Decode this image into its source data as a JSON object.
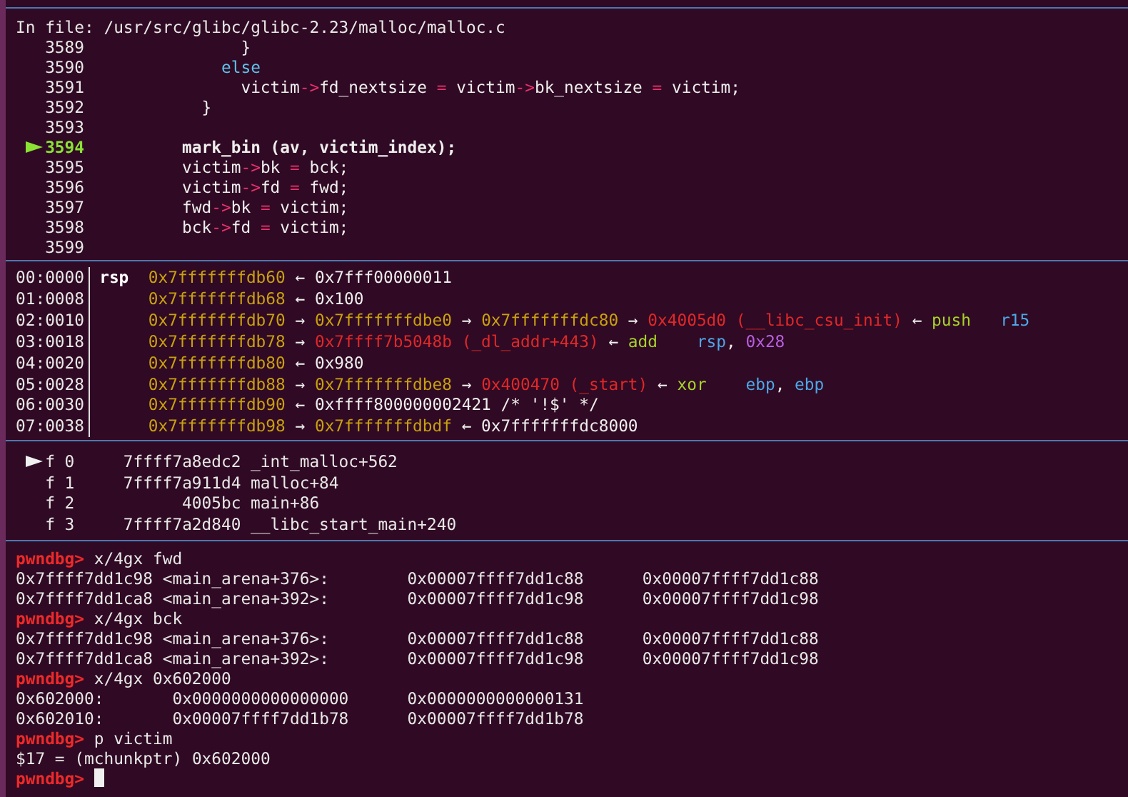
{
  "source": {
    "file_label": "In file: /usr/src/glibc/glibc-2.23/malloc/malloc.c",
    "lines": [
      {
        "number": "3589",
        "current": false,
        "code": [
          {
            "kind": "plain",
            "text": "                }"
          }
        ]
      },
      {
        "number": "3590",
        "current": false,
        "code": [
          {
            "kind": "keyword",
            "text": "              else"
          }
        ]
      },
      {
        "number": "3591",
        "current": false,
        "code": [
          {
            "kind": "plain",
            "text": "                victim"
          },
          {
            "kind": "op",
            "text": "->"
          },
          {
            "kind": "plain",
            "text": "fd_nextsize "
          },
          {
            "kind": "op",
            "text": "="
          },
          {
            "kind": "plain",
            "text": " victim"
          },
          {
            "kind": "op",
            "text": "->"
          },
          {
            "kind": "plain",
            "text": "bk_nextsize "
          },
          {
            "kind": "op",
            "text": "="
          },
          {
            "kind": "plain",
            "text": " victim;"
          }
        ]
      },
      {
        "number": "3592",
        "current": false,
        "code": [
          {
            "kind": "plain",
            "text": "            }"
          }
        ]
      },
      {
        "number": "3593",
        "current": false
      },
      {
        "number": "3594",
        "current": true,
        "code": [
          {
            "kind": "plain",
            "text": "          mark_bin (av, victim_index);"
          }
        ]
      },
      {
        "number": "3595",
        "current": false,
        "code": [
          {
            "kind": "plain",
            "text": "          victim"
          },
          {
            "kind": "op",
            "text": "->"
          },
          {
            "kind": "plain",
            "text": "bk "
          },
          {
            "kind": "op",
            "text": "="
          },
          {
            "kind": "plain",
            "text": " bck;"
          }
        ]
      },
      {
        "number": "3596",
        "current": false,
        "code": [
          {
            "kind": "plain",
            "text": "          victim"
          },
          {
            "kind": "op",
            "text": "->"
          },
          {
            "kind": "plain",
            "text": "fd "
          },
          {
            "kind": "op",
            "text": "="
          },
          {
            "kind": "plain",
            "text": " fwd;"
          }
        ]
      },
      {
        "number": "3597",
        "current": false,
        "code": [
          {
            "kind": "plain",
            "text": "          fwd"
          },
          {
            "kind": "op",
            "text": "->"
          },
          {
            "kind": "plain",
            "text": "bk "
          },
          {
            "kind": "op",
            "text": "="
          },
          {
            "kind": "plain",
            "text": " victim;"
          }
        ]
      },
      {
        "number": "3598",
        "current": false,
        "code": [
          {
            "kind": "plain",
            "text": "          bck"
          },
          {
            "kind": "op",
            "text": "->"
          },
          {
            "kind": "plain",
            "text": "fd "
          },
          {
            "kind": "op",
            "text": "="
          },
          {
            "kind": "plain",
            "text": " victim;"
          }
        ]
      },
      {
        "number": "3599",
        "current": false
      }
    ]
  },
  "stack": [
    {
      "offset": "00:0000",
      "register": "rsp",
      "segments": [
        {
          "kind": "address",
          "text": "0x7fffffffdb60"
        },
        {
          "kind": "plain",
          "text": " ← 0x7fff00000011"
        }
      ]
    },
    {
      "offset": "01:0008",
      "segments": [
        {
          "kind": "address",
          "text": "0x7fffffffdb68"
        },
        {
          "kind": "plain",
          "text": " ← 0x100"
        }
      ]
    },
    {
      "offset": "02:0010",
      "segments": [
        {
          "kind": "address",
          "text": "0x7fffffffdb70"
        },
        {
          "kind": "plain",
          "text": " → "
        },
        {
          "kind": "address",
          "text": "0x7fffffffdbe0"
        },
        {
          "kind": "plain",
          "text": " → "
        },
        {
          "kind": "address",
          "text": "0x7fffffffdc80"
        },
        {
          "kind": "plain",
          "text": " → "
        },
        {
          "kind": "code",
          "text": "0x4005d0 (__libc_csu_init)"
        },
        {
          "kind": "plain",
          "text": " ← "
        },
        {
          "kind": "instruction",
          "text": "push   "
        },
        {
          "kind": "register",
          "text": "r15"
        }
      ]
    },
    {
      "offset": "03:0018",
      "segments": [
        {
          "kind": "address",
          "text": "0x7fffffffdb78"
        },
        {
          "kind": "plain",
          "text": " → "
        },
        {
          "kind": "code",
          "text": "0x7ffff7b5048b (_dl_addr+443)"
        },
        {
          "kind": "plain",
          "text": " ← "
        },
        {
          "kind": "instruction",
          "text": "add    "
        },
        {
          "kind": "register",
          "text": "rsp"
        },
        {
          "kind": "plain",
          "text": ", "
        },
        {
          "kind": "immediate",
          "text": "0x28"
        }
      ]
    },
    {
      "offset": "04:0020",
      "segments": [
        {
          "kind": "address",
          "text": "0x7fffffffdb80"
        },
        {
          "kind": "plain",
          "text": " ← 0x980"
        }
      ]
    },
    {
      "offset": "05:0028",
      "segments": [
        {
          "kind": "address",
          "text": "0x7fffffffdb88"
        },
        {
          "kind": "plain",
          "text": " → "
        },
        {
          "kind": "address",
          "text": "0x7fffffffdbe8"
        },
        {
          "kind": "plain",
          "text": " → "
        },
        {
          "kind": "code",
          "text": "0x400470 (_start)"
        },
        {
          "kind": "plain",
          "text": " ← "
        },
        {
          "kind": "instruction",
          "text": "xor    "
        },
        {
          "kind": "register",
          "text": "ebp"
        },
        {
          "kind": "plain",
          "text": ", "
        },
        {
          "kind": "register",
          "text": "ebp"
        }
      ]
    },
    {
      "offset": "06:0030",
      "segments": [
        {
          "kind": "address",
          "text": "0x7fffffffdb90"
        },
        {
          "kind": "plain",
          "text": " ← 0xffff800000002421 /* '!$' */"
        }
      ]
    },
    {
      "offset": "07:0038",
      "segments": [
        {
          "kind": "address",
          "text": "0x7fffffffdb98"
        },
        {
          "kind": "plain",
          "text": " → "
        },
        {
          "kind": "address",
          "text": "0x7fffffffdbdf"
        },
        {
          "kind": "plain",
          "text": " ← 0x7fffffffdc8000"
        }
      ]
    }
  ],
  "backtrace": [
    {
      "label": "f 0",
      "address": "7ffff7a8edc2",
      "symbol": "_int_malloc+562",
      "selected": true
    },
    {
      "label": "f 1",
      "address": "7ffff7a911d4",
      "symbol": "malloc+84",
      "selected": false
    },
    {
      "label": "f 2",
      "address": "4005bc",
      "symbol": "main+86",
      "selected": false
    },
    {
      "label": "f 3",
      "address": "7ffff7a2d840",
      "symbol": "__libc_start_main+240",
      "selected": false
    }
  ],
  "console": [
    {
      "kind": "prompt",
      "prompt": "pwndbg>",
      "text": "x/4gx fwd"
    },
    {
      "kind": "output",
      "text": "0x7ffff7dd1c98 <main_arena+376>:        0x00007ffff7dd1c88      0x00007ffff7dd1c88"
    },
    {
      "kind": "output",
      "text": "0x7ffff7dd1ca8 <main_arena+392>:        0x00007ffff7dd1c98      0x00007ffff7dd1c98"
    },
    {
      "kind": "prompt",
      "prompt": "pwndbg>",
      "text": "x/4gx bck"
    },
    {
      "kind": "output",
      "text": "0x7ffff7dd1c98 <main_arena+376>:        0x00007ffff7dd1c88      0x00007ffff7dd1c88"
    },
    {
      "kind": "output",
      "text": "0x7ffff7dd1ca8 <main_arena+392>:        0x00007ffff7dd1c98      0x00007ffff7dd1c98"
    },
    {
      "kind": "prompt",
      "prompt": "pwndbg>",
      "text": "x/4gx 0x602000"
    },
    {
      "kind": "output",
      "text": "0x602000:       0x0000000000000000      0x0000000000000131"
    },
    {
      "kind": "output",
      "text": "0x602010:       0x00007ffff7dd1b78      0x00007ffff7dd1b78"
    },
    {
      "kind": "prompt",
      "prompt": "pwndbg>",
      "text": "p victim"
    },
    {
      "kind": "output",
      "text": "$17 = (mchunkptr) 0x602000"
    },
    {
      "kind": "prompt",
      "prompt": "pwndbg>",
      "cursor": true
    }
  ]
}
